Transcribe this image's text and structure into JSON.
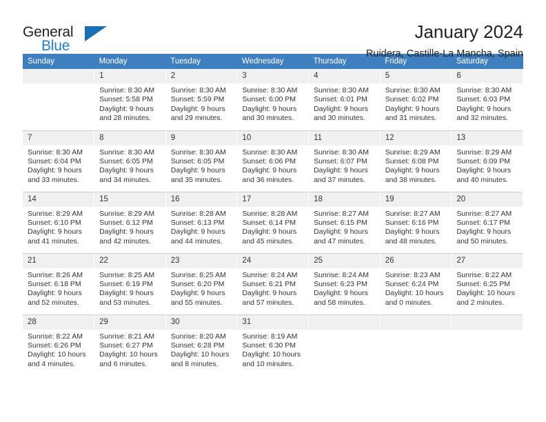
{
  "brand": {
    "name_part1": "General",
    "name_part2": "Blue",
    "logo_icon": "triangle-logo"
  },
  "header": {
    "month_title": "January 2024",
    "location": "Ruidera, Castille-La Mancha, Spain"
  },
  "calendar": {
    "weekday_headers": [
      "Sunday",
      "Monday",
      "Tuesday",
      "Wednesday",
      "Thursday",
      "Friday",
      "Saturday"
    ],
    "accent_color": "#3f7fbf",
    "weeks": [
      [
        {
          "day": "",
          "lines": []
        },
        {
          "day": "1",
          "lines": [
            "Sunrise: 8:30 AM",
            "Sunset: 5:58 PM",
            "Daylight: 9 hours",
            "and 28 minutes."
          ]
        },
        {
          "day": "2",
          "lines": [
            "Sunrise: 8:30 AM",
            "Sunset: 5:59 PM",
            "Daylight: 9 hours",
            "and 29 minutes."
          ]
        },
        {
          "day": "3",
          "lines": [
            "Sunrise: 8:30 AM",
            "Sunset: 6:00 PM",
            "Daylight: 9 hours",
            "and 30 minutes."
          ]
        },
        {
          "day": "4",
          "lines": [
            "Sunrise: 8:30 AM",
            "Sunset: 6:01 PM",
            "Daylight: 9 hours",
            "and 30 minutes."
          ]
        },
        {
          "day": "5",
          "lines": [
            "Sunrise: 8:30 AM",
            "Sunset: 6:02 PM",
            "Daylight: 9 hours",
            "and 31 minutes."
          ]
        },
        {
          "day": "6",
          "lines": [
            "Sunrise: 8:30 AM",
            "Sunset: 6:03 PM",
            "Daylight: 9 hours",
            "and 32 minutes."
          ]
        }
      ],
      [
        {
          "day": "7",
          "lines": [
            "Sunrise: 8:30 AM",
            "Sunset: 6:04 PM",
            "Daylight: 9 hours",
            "and 33 minutes."
          ]
        },
        {
          "day": "8",
          "lines": [
            "Sunrise: 8:30 AM",
            "Sunset: 6:05 PM",
            "Daylight: 9 hours",
            "and 34 minutes."
          ]
        },
        {
          "day": "9",
          "lines": [
            "Sunrise: 8:30 AM",
            "Sunset: 6:05 PM",
            "Daylight: 9 hours",
            "and 35 minutes."
          ]
        },
        {
          "day": "10",
          "lines": [
            "Sunrise: 8:30 AM",
            "Sunset: 6:06 PM",
            "Daylight: 9 hours",
            "and 36 minutes."
          ]
        },
        {
          "day": "11",
          "lines": [
            "Sunrise: 8:30 AM",
            "Sunset: 6:07 PM",
            "Daylight: 9 hours",
            "and 37 minutes."
          ]
        },
        {
          "day": "12",
          "lines": [
            "Sunrise: 8:29 AM",
            "Sunset: 6:08 PM",
            "Daylight: 9 hours",
            "and 38 minutes."
          ]
        },
        {
          "day": "13",
          "lines": [
            "Sunrise: 8:29 AM",
            "Sunset: 6:09 PM",
            "Daylight: 9 hours",
            "and 40 minutes."
          ]
        }
      ],
      [
        {
          "day": "14",
          "lines": [
            "Sunrise: 8:29 AM",
            "Sunset: 6:10 PM",
            "Daylight: 9 hours",
            "and 41 minutes."
          ]
        },
        {
          "day": "15",
          "lines": [
            "Sunrise: 8:29 AM",
            "Sunset: 6:12 PM",
            "Daylight: 9 hours",
            "and 42 minutes."
          ]
        },
        {
          "day": "16",
          "lines": [
            "Sunrise: 8:28 AM",
            "Sunset: 6:13 PM",
            "Daylight: 9 hours",
            "and 44 minutes."
          ]
        },
        {
          "day": "17",
          "lines": [
            "Sunrise: 8:28 AM",
            "Sunset: 6:14 PM",
            "Daylight: 9 hours",
            "and 45 minutes."
          ]
        },
        {
          "day": "18",
          "lines": [
            "Sunrise: 8:27 AM",
            "Sunset: 6:15 PM",
            "Daylight: 9 hours",
            "and 47 minutes."
          ]
        },
        {
          "day": "19",
          "lines": [
            "Sunrise: 8:27 AM",
            "Sunset: 6:16 PM",
            "Daylight: 9 hours",
            "and 48 minutes."
          ]
        },
        {
          "day": "20",
          "lines": [
            "Sunrise: 8:27 AM",
            "Sunset: 6:17 PM",
            "Daylight: 9 hours",
            "and 50 minutes."
          ]
        }
      ],
      [
        {
          "day": "21",
          "lines": [
            "Sunrise: 8:26 AM",
            "Sunset: 6:18 PM",
            "Daylight: 9 hours",
            "and 52 minutes."
          ]
        },
        {
          "day": "22",
          "lines": [
            "Sunrise: 8:25 AM",
            "Sunset: 6:19 PM",
            "Daylight: 9 hours",
            "and 53 minutes."
          ]
        },
        {
          "day": "23",
          "lines": [
            "Sunrise: 8:25 AM",
            "Sunset: 6:20 PM",
            "Daylight: 9 hours",
            "and 55 minutes."
          ]
        },
        {
          "day": "24",
          "lines": [
            "Sunrise: 8:24 AM",
            "Sunset: 6:21 PM",
            "Daylight: 9 hours",
            "and 57 minutes."
          ]
        },
        {
          "day": "25",
          "lines": [
            "Sunrise: 8:24 AM",
            "Sunset: 6:23 PM",
            "Daylight: 9 hours",
            "and 58 minutes."
          ]
        },
        {
          "day": "26",
          "lines": [
            "Sunrise: 8:23 AM",
            "Sunset: 6:24 PM",
            "Daylight: 10 hours",
            "and 0 minutes."
          ]
        },
        {
          "day": "27",
          "lines": [
            "Sunrise: 8:22 AM",
            "Sunset: 6:25 PM",
            "Daylight: 10 hours",
            "and 2 minutes."
          ]
        }
      ],
      [
        {
          "day": "28",
          "lines": [
            "Sunrise: 8:22 AM",
            "Sunset: 6:26 PM",
            "Daylight: 10 hours",
            "and 4 minutes."
          ]
        },
        {
          "day": "29",
          "lines": [
            "Sunrise: 8:21 AM",
            "Sunset: 6:27 PM",
            "Daylight: 10 hours",
            "and 6 minutes."
          ]
        },
        {
          "day": "30",
          "lines": [
            "Sunrise: 8:20 AM",
            "Sunset: 6:28 PM",
            "Daylight: 10 hours",
            "and 8 minutes."
          ]
        },
        {
          "day": "31",
          "lines": [
            "Sunrise: 8:19 AM",
            "Sunset: 6:30 PM",
            "Daylight: 10 hours",
            "and 10 minutes."
          ]
        },
        {
          "day": "",
          "lines": []
        },
        {
          "day": "",
          "lines": []
        },
        {
          "day": "",
          "lines": []
        }
      ]
    ]
  }
}
